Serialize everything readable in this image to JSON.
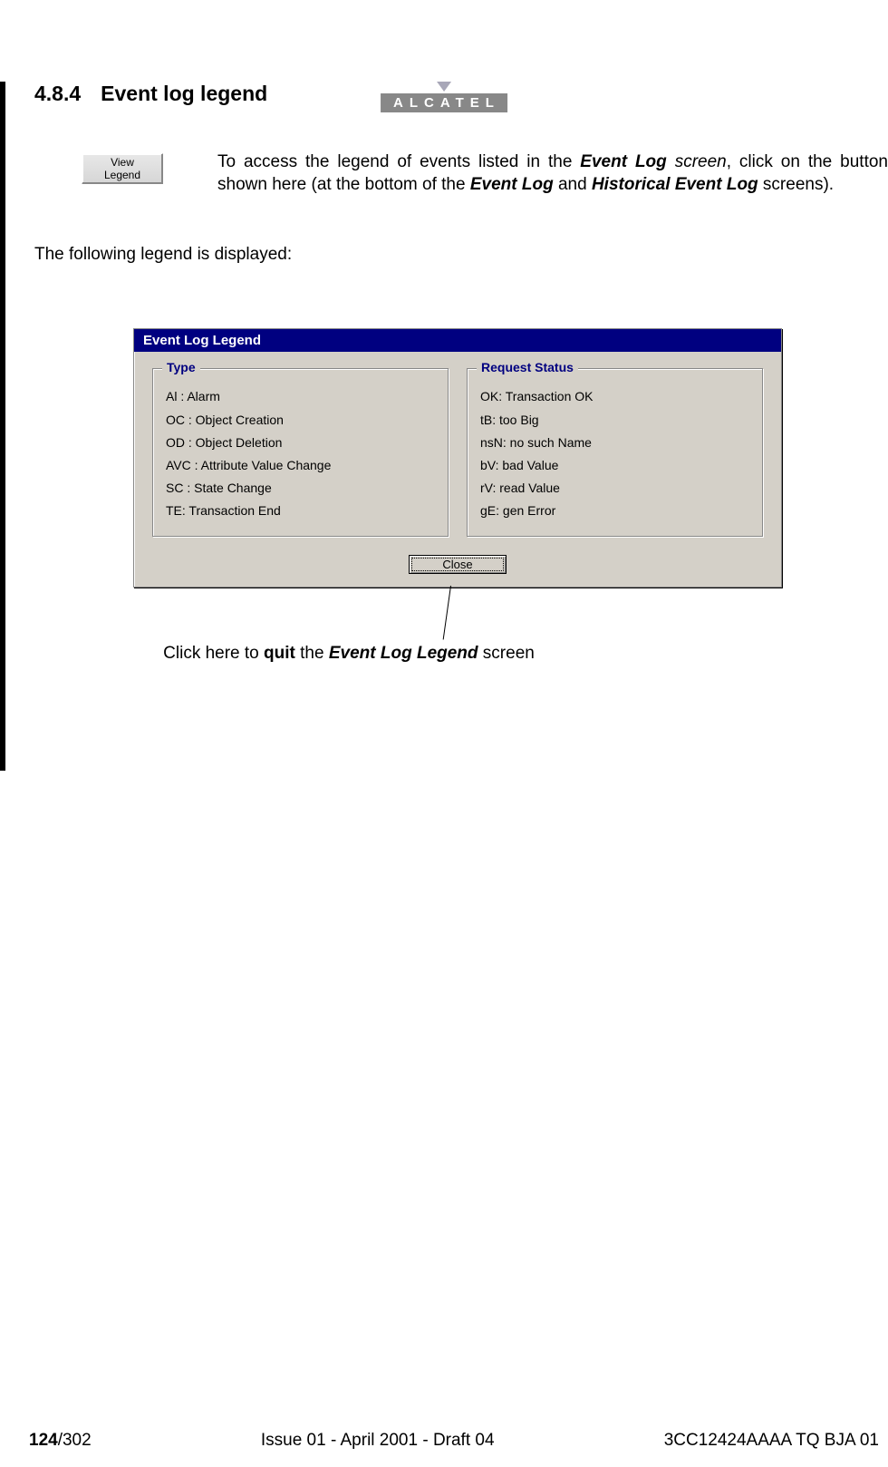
{
  "brand": "ALCATEL",
  "section": {
    "number": "4.8.4",
    "title": "Event log legend"
  },
  "view_legend_button": "View Legend",
  "intro": {
    "t1": "To access the legend of events listed in the ",
    "bold1": "Event Log",
    "italic1": " screen",
    "t2": ", click on the button shown here (at the bottom of the ",
    "bold2": "Event Log",
    "t3": " and ",
    "bold3": "Historical Event Log",
    "t4": " screens)."
  },
  "following": "The following legend is displayed:",
  "dialog": {
    "title": "Event Log Legend",
    "type_group": {
      "title": "Type",
      "items": [
        "Al : Alarm",
        "OC : Object Creation",
        "OD : Object Deletion",
        "AVC : Attribute Value Change",
        "SC : State Change",
        "TE: Transaction End"
      ]
    },
    "status_group": {
      "title": "Request Status",
      "items": [
        "OK: Transaction OK",
        "tB: too Big",
        "nsN: no such Name",
        "bV: bad Value",
        "rV: read Value",
        "gE: gen Error"
      ]
    },
    "close": "Close"
  },
  "callout": {
    "t1": "Click here to ",
    "bold1": "quit",
    "t2": " the ",
    "bolditalic": "Event Log Legend",
    "t3": " screen"
  },
  "footer": {
    "left_bold": "124",
    "left_rest": "/302",
    "center": "Issue 01 - April 2001 - Draft 04",
    "right": "3CC12424AAAA TQ BJA 01"
  }
}
